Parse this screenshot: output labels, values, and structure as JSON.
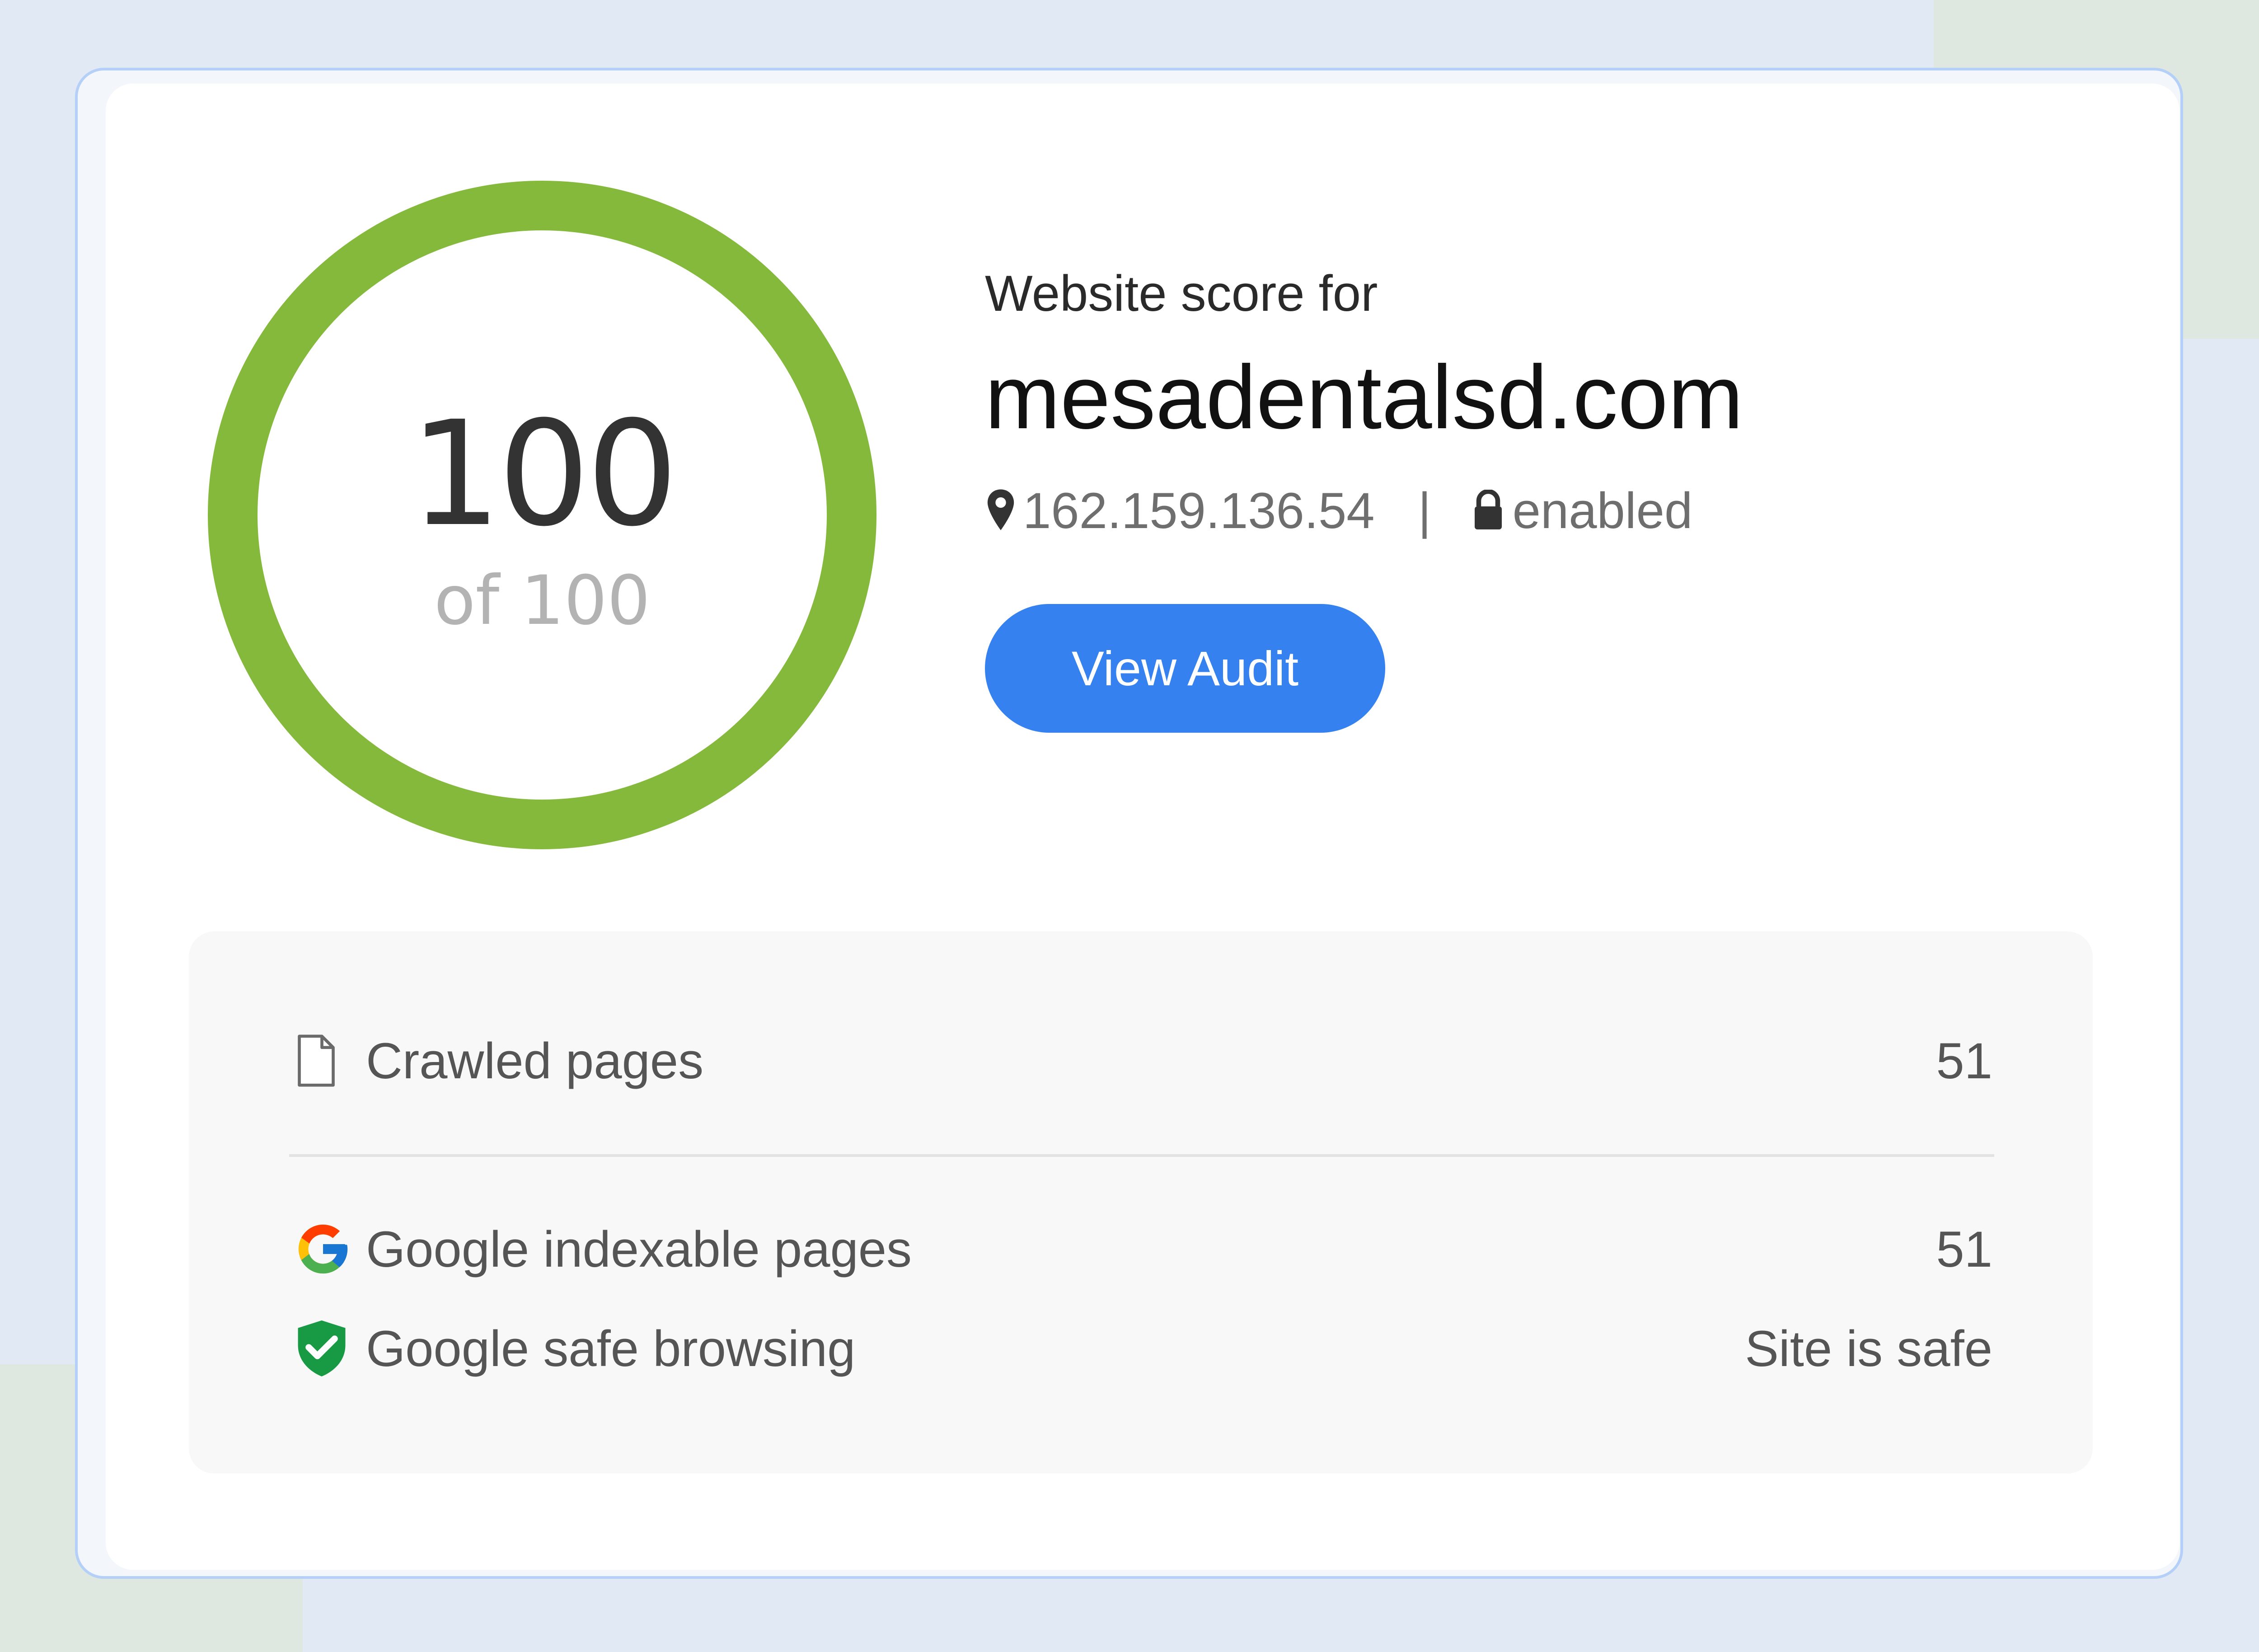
{
  "score": {
    "value": "100",
    "of_label": "of 100",
    "ring_color": "#84b93b"
  },
  "site": {
    "label": "Website score for",
    "domain": "mesadentalsd.com",
    "ip": "162.159.136.54",
    "separator": "|",
    "ssl_status": "enabled",
    "ip_icon": "map-pin-icon",
    "ssl_icon": "lock-icon"
  },
  "actions": {
    "view_audit_label": "View Audit",
    "button_color": "#3581f0"
  },
  "stats": [
    {
      "icon": "document-icon",
      "label": "Crawled pages",
      "value": "51"
    },
    {
      "icon": "google-icon",
      "label": "Google indexable pages",
      "value": "51"
    },
    {
      "icon": "shield-check-icon",
      "label": "Google safe browsing",
      "value": "Site is safe"
    }
  ]
}
